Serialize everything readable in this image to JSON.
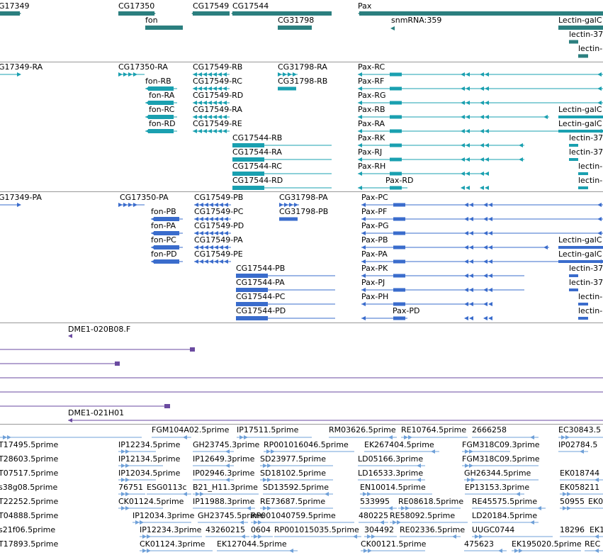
{
  "track_colors": {
    "genes": "#2b7f7f",
    "transcripts_ra": "#1aa0b0",
    "transcripts_pa": "#3a6ccc",
    "cdna": "#6a4aa0",
    "est": "#6fa0d8",
    "separator": "#999999"
  },
  "genes": [
    "G17349",
    "CG17350",
    "CG17549",
    "CG17544",
    "Pax",
    "fon",
    "CG31798",
    "snmRNA:359",
    "Lectin-galC",
    "lectin-37",
    "lectin-"
  ],
  "rna_transcripts": [
    "G17349-RA",
    "CG17350-RA",
    "CG17549-RB",
    "CG31798-RA",
    "Pax-RC",
    "fon-RB",
    "CG17549-RC",
    "CG31798-RB",
    "Pax-RF",
    "fon-RA",
    "CG17549-RD",
    "Pax-RG",
    "fon-RC",
    "CG17549-RA",
    "Pax-RB",
    "Lectin-galC",
    "fon-RD",
    "CG17549-RE",
    "Pax-RA",
    "Lectin-galC",
    "CG17544-RB",
    "Pax-RK",
    "lectin-37",
    "CG17544-RA",
    "Pax-RJ",
    "lectin-37",
    "CG17544-RC",
    "Pax-RH",
    "lectin-",
    "CG17544-RD",
    "Pax-RD",
    "lectin-"
  ],
  "protein_transcripts": [
    "G17349-PA",
    "CG17350-PA",
    "CG17549-PB",
    "CG31798-PA",
    "Pax-PC",
    "fon-PB",
    "CG17549-PC",
    "CG31798-PB",
    "Pax-PF",
    "fon-PA",
    "CG17549-PD",
    "Pax-PG",
    "fon-PC",
    "CG17549-PA",
    "Pax-PB",
    "Lectin-galC",
    "fon-PD",
    "CG17549-PE",
    "Pax-PA",
    "Lectin-galC",
    "CG17544-PB",
    "Pax-PK",
    "lectin-37",
    "CG17544-PA",
    "Pax-PJ",
    "lectin-37",
    "CG17544-PC",
    "Pax-PH",
    "lectin-",
    "CG17544-PD",
    "Pax-PD",
    "lectin-"
  ],
  "cdna_clones": [
    "DME1-020B08.F",
    "DME1-021H01"
  ],
  "est_labels": [
    "FGM104A02.5prime",
    "IP17511.5prime",
    "RM03626.5prime",
    "RE10764.5prime",
    "2666258",
    "EC30843.5",
    "T17495.5prime",
    "IP12234.5prime",
    "GH23745.3prime",
    "RP001016046.5prime",
    "EK267404.5prime",
    "FGM318C09.3prime",
    "IP02784.5",
    "T28603.5prime",
    "IP12134.5prime",
    "IP12649.3prime",
    "SD23977.5prime",
    "LD05166.3prime",
    "FGM318C09.5prime",
    "T07517.5prime",
    "IP12034.5prime",
    "IP02946.3prime",
    "SD18102.5prime",
    "LD16533.3prime",
    "GH26344.5prime",
    "EK018744",
    "s38g08.5prime",
    "76751",
    "ESG0113c",
    "B21_H11.3prime",
    "SD13592.5prime",
    "EN10014.5prime",
    "EP13153.3prime",
    "EK058211",
    "T22252.5prime",
    "CK01124.5prime",
    "IP11988.3prime",
    "RE73687.5prime",
    "533995",
    "RE08618.5prime",
    "RE45575.5prime",
    "50955",
    "EK0",
    "T04888.5prime",
    "IP12034.3prime",
    "GH23745.5prime",
    "RP001040759.5prime",
    "480225",
    "RE58092.5prime",
    "LD20184.5prime",
    "s21f06.5prime",
    "IP12234.3prime",
    "43260215",
    "0604",
    "RP001015035.5prime",
    "304492",
    "RE02336.5prime",
    "UUGC0744",
    "18296",
    "EK1",
    "T17893.5prime",
    "CK01124.3prime",
    "EK127044.5prime",
    "CK00121.5prime",
    "475623",
    "EK195020.5prime",
    "REC"
  ]
}
